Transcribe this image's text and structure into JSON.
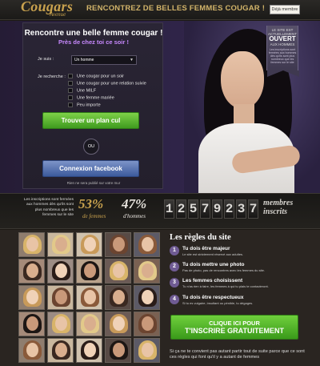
{
  "header": {
    "logo_main": "Cougars",
    "logo_sub": "Avenue",
    "tagline": "RENCONTREZ DE BELLES FEMMES COUGAR !",
    "member_button": "Déjà membre"
  },
  "form": {
    "title": "Rencontre une belle femme cougar !",
    "subtitle": "Près de chez toi ce soir !",
    "i_am_label": "Je suis :",
    "i_am_value": "Un homme",
    "looking_label": "Je recherche :",
    "options": [
      "Une cougar pour un soir",
      "Une cougar pour une relation suivie",
      "Une MILF",
      "Une femme mariée",
      "Peu importe"
    ],
    "submit_button": "Trouver un plan cul",
    "or_label": "OU",
    "facebook_button": "Connexion facebook",
    "legal": "Rien ne sera publié sur votre mur"
  },
  "ribbon": {
    "line1": "LE SITE EST",
    "line2": "ACTUELLEMENT",
    "big": "OUVERT",
    "line3": "AUX HOMMES",
    "small": "Les inscriptions sont fermées aux hommes dès qu'ils sont plus nombreux que les femmes sur le site"
  },
  "stats": {
    "text": "Les inscriptions sont fermées aux hommes dès qu'ils sont plus nombreux que les femmes sur le site",
    "women_pct": "53%",
    "women_label": "de femmes",
    "men_pct": "47%",
    "men_label": "d'hommes",
    "counter_digits": [
      "1",
      "2",
      "5",
      "7",
      "9",
      "2",
      "3",
      "7"
    ],
    "members_label_1": "membres",
    "members_label_2": "inscrits"
  },
  "rules": {
    "title": "Les règles du site",
    "items": [
      {
        "num": "1",
        "title": "Tu dois être majeur",
        "desc": "Le site est strictement réservé aux adultes."
      },
      {
        "num": "2",
        "title": "Tu dois mettre une photo",
        "desc": "Pas de photo, pas de rencontres avec les femmes du site."
      },
      {
        "num": "3",
        "title": "Les femmes choisissent",
        "desc": "Tu n'as rien à faire, les femmes à qui tu plais te contacteront."
      },
      {
        "num": "4",
        "title": "Tu dois être respectueux",
        "desc": "Si tu es vulgaire, insultant ou pénible, tu dégages."
      }
    ],
    "cta_line1": "CLIQUE ICI POUR",
    "cta_line2": "T'INSCRIRE GRATUITEMENT",
    "bottom_text": "Si ça ne te convient pas autant partir tout de suite parce que ce sont ces règles qui font qu'il y a autant de femmes"
  },
  "colors": {
    "accent_gold": "#c9a24e",
    "accent_purple": "#c889ff",
    "button_green": "#4caf28",
    "button_facebook": "#4a66a8",
    "women_pct": "#c9a24e",
    "men_pct": "#e8e4de"
  },
  "gallery": {
    "count": 25
  }
}
